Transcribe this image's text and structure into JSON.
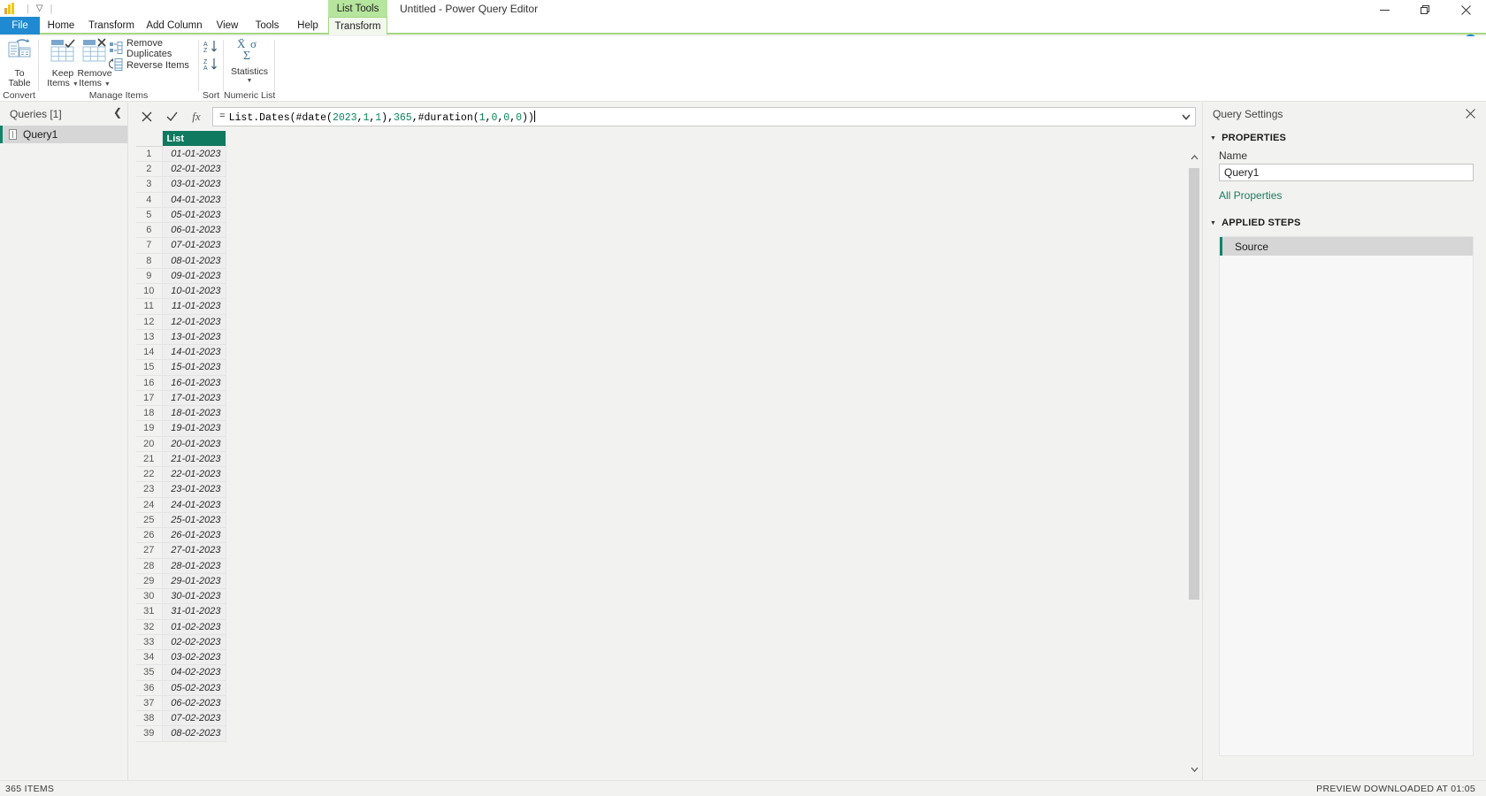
{
  "window": {
    "title": "Untitled - Power Query Editor",
    "controls": {
      "minimize": "minimize-icon",
      "restore": "restore-icon",
      "close": "close-icon"
    },
    "quick_access": {
      "logo": "power-query-logo",
      "customize": "customize-qat-icon"
    }
  },
  "context_tab_header": "List Tools",
  "ribbon": {
    "tabs": [
      {
        "label": "File"
      },
      {
        "label": "Home"
      },
      {
        "label": "Transform"
      },
      {
        "label": "Add Column"
      },
      {
        "label": "View"
      },
      {
        "label": "Tools"
      },
      {
        "label": "Help"
      },
      {
        "label": "Transform"
      }
    ],
    "collapse_icon": "chevron-up-icon",
    "help_icon": "?",
    "groups": [
      {
        "name": "Convert",
        "items": [
          {
            "label": "To\nTable",
            "line1": "To",
            "line2": "Table",
            "icon": "to-table-icon"
          }
        ]
      },
      {
        "name": "Manage Items",
        "items": [
          {
            "line1": "Keep",
            "line2": "Items",
            "icon": "keep-items-icon",
            "has_caret": true
          },
          {
            "line1": "Remove",
            "line2": "Items",
            "icon": "remove-items-icon",
            "has_caret": true
          },
          {
            "label": "Remove Duplicates",
            "icon": "remove-duplicates-icon"
          },
          {
            "label": "Reverse Items",
            "icon": "reverse-items-icon"
          }
        ]
      },
      {
        "name": "Sort",
        "items": [
          {
            "label": "",
            "icon": "sort-ascending-icon"
          },
          {
            "label": "",
            "icon": "sort-descending-icon"
          }
        ]
      },
      {
        "name": "Numeric List",
        "items": [
          {
            "label": "Statistics",
            "icon": "statistics-icon",
            "has_caret": true
          }
        ]
      }
    ]
  },
  "queries_pane": {
    "header": "Queries [1]",
    "collapse_icon": "chevron-left-icon",
    "items": [
      {
        "label": "Query1",
        "icon": "list-query-icon",
        "selected": true
      }
    ]
  },
  "formula_bar": {
    "cancel_icon": "cancel-x-icon",
    "accept_icon": "accept-check-icon",
    "fx_icon": "fx-icon",
    "equals": "=",
    "formula": "List.Dates(#date(2023,1,1),365,#duration(1,0,0,0))",
    "tokens": [
      {
        "t": "List.Dates(#date(",
        "k": "fn"
      },
      {
        "t": "2023",
        "k": "num"
      },
      {
        "t": ",",
        "k": "punc"
      },
      {
        "t": "1",
        "k": "num"
      },
      {
        "t": ",",
        "k": "punc"
      },
      {
        "t": "1",
        "k": "num"
      },
      {
        "t": "),",
        "k": "punc"
      },
      {
        "t": "365",
        "k": "num"
      },
      {
        "t": ",#duration(",
        "k": "fn"
      },
      {
        "t": "1",
        "k": "num"
      },
      {
        "t": ",",
        "k": "punc"
      },
      {
        "t": "0",
        "k": "num"
      },
      {
        "t": ",",
        "k": "punc"
      },
      {
        "t": "0",
        "k": "num"
      },
      {
        "t": ",",
        "k": "punc"
      },
      {
        "t": "0",
        "k": "num"
      },
      {
        "t": "))",
        "k": "punc"
      }
    ],
    "dropdown_icon": "chevron-down-icon"
  },
  "grid": {
    "column_header": "List",
    "rows": [
      {
        "n": "1",
        "v": "01-01-2023"
      },
      {
        "n": "2",
        "v": "02-01-2023"
      },
      {
        "n": "3",
        "v": "03-01-2023"
      },
      {
        "n": "4",
        "v": "04-01-2023"
      },
      {
        "n": "5",
        "v": "05-01-2023"
      },
      {
        "n": "6",
        "v": "06-01-2023"
      },
      {
        "n": "7",
        "v": "07-01-2023"
      },
      {
        "n": "8",
        "v": "08-01-2023"
      },
      {
        "n": "9",
        "v": "09-01-2023"
      },
      {
        "n": "10",
        "v": "10-01-2023"
      },
      {
        "n": "11",
        "v": "11-01-2023"
      },
      {
        "n": "12",
        "v": "12-01-2023"
      },
      {
        "n": "13",
        "v": "13-01-2023"
      },
      {
        "n": "14",
        "v": "14-01-2023"
      },
      {
        "n": "15",
        "v": "15-01-2023"
      },
      {
        "n": "16",
        "v": "16-01-2023"
      },
      {
        "n": "17",
        "v": "17-01-2023"
      },
      {
        "n": "18",
        "v": "18-01-2023"
      },
      {
        "n": "19",
        "v": "19-01-2023"
      },
      {
        "n": "20",
        "v": "20-01-2023"
      },
      {
        "n": "21",
        "v": "21-01-2023"
      },
      {
        "n": "22",
        "v": "22-01-2023"
      },
      {
        "n": "23",
        "v": "23-01-2023"
      },
      {
        "n": "24",
        "v": "24-01-2023"
      },
      {
        "n": "25",
        "v": "25-01-2023"
      },
      {
        "n": "26",
        "v": "26-01-2023"
      },
      {
        "n": "27",
        "v": "27-01-2023"
      },
      {
        "n": "28",
        "v": "28-01-2023"
      },
      {
        "n": "29",
        "v": "29-01-2023"
      },
      {
        "n": "30",
        "v": "30-01-2023"
      },
      {
        "n": "31",
        "v": "31-01-2023"
      },
      {
        "n": "32",
        "v": "01-02-2023"
      },
      {
        "n": "33",
        "v": "02-02-2023"
      },
      {
        "n": "34",
        "v": "03-02-2023"
      },
      {
        "n": "35",
        "v": "04-02-2023"
      },
      {
        "n": "36",
        "v": "05-02-2023"
      },
      {
        "n": "37",
        "v": "06-02-2023"
      },
      {
        "n": "38",
        "v": "07-02-2023"
      },
      {
        "n": "39",
        "v": "08-02-2023"
      }
    ],
    "scrollbar": {
      "up_icon": "chevron-up-icon",
      "down_icon": "chevron-down-icon"
    }
  },
  "query_settings": {
    "title": "Query Settings",
    "close_icon": "close-icon",
    "properties_section": "PROPERTIES",
    "name_label": "Name",
    "name_value": "Query1",
    "all_properties_link": "All Properties",
    "applied_steps_section": "APPLIED STEPS",
    "steps": [
      {
        "label": "Source",
        "selected": true
      }
    ]
  },
  "status_bar": {
    "left": "365 ITEMS",
    "right": "PREVIEW DOWNLOADED AT 01:05"
  },
  "colors": {
    "accent_blue": "#1f8ad2",
    "context_green": "#a4d882",
    "context_green_light": "#b6e59e",
    "header_teal": "#0f7a60",
    "step_accent": "#10846a",
    "link_teal": "#1a7a5e",
    "number_token": "#098658"
  }
}
